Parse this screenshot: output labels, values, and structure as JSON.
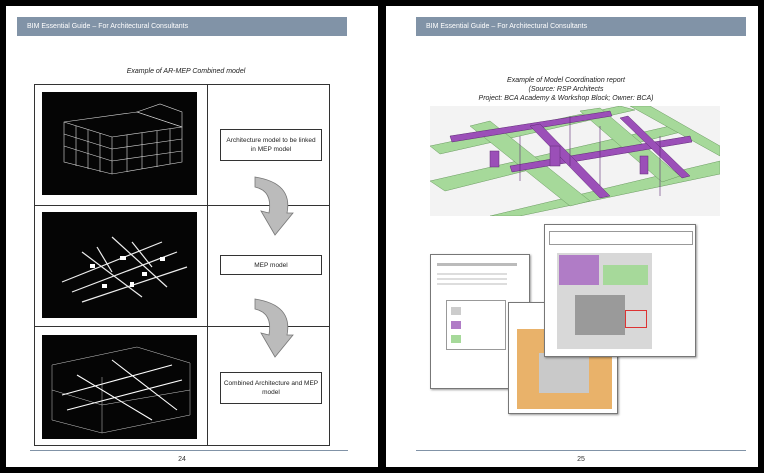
{
  "left_page": {
    "header": "BIM Essential Guide – For Architectural Consultants",
    "caption": "Example of AR-MEP Combined model",
    "rows": [
      {
        "label": "Architecture model to be linked in MEP model"
      },
      {
        "label": "MEP model"
      },
      {
        "label": "Combined Architecture and MEP model"
      }
    ],
    "page_number": "24"
  },
  "right_page": {
    "header": "BIM Essential Guide – For Architectural Consultants",
    "caption_line1": "Example of Model Coordination report",
    "caption_line2": "(Source: RSP Architects",
    "caption_line3": "Project: BCA Academy & Workshop Block; Owner: BCA)",
    "page_number": "25"
  },
  "colors": {
    "header_bar": "#8193a7",
    "mep_purple": "#9b4fb8",
    "mep_green": "#a6d99a"
  }
}
